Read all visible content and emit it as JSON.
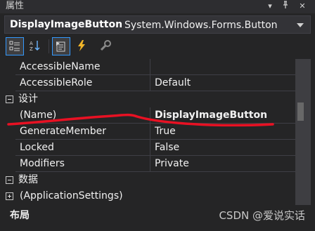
{
  "window": {
    "title": "属性",
    "pin_glyph": "▾",
    "autohide_glyph": "⊣",
    "close_glyph": "✕"
  },
  "object_selector": {
    "name": "DisplayImageButton",
    "type": "System.Windows.Forms.Button"
  },
  "toolbar": {
    "buttons": [
      {
        "icon": "categorized-icon",
        "active": true
      },
      {
        "icon": "alphabetical-icon",
        "active": false
      },
      {
        "icon": "properties-icon",
        "active": true
      },
      {
        "icon": "events-lightning-icon",
        "active": false
      },
      {
        "icon": "property-pages-wrench-icon",
        "active": false
      }
    ]
  },
  "grid": {
    "rows_top": [
      {
        "name": "AccessibleName",
        "value": ""
      },
      {
        "name": "AccessibleRole",
        "value": "Default"
      }
    ],
    "category_design": "设计",
    "rows_design": [
      {
        "name": "(Name)",
        "value": "DisplayImageButton"
      },
      {
        "name": "GenerateMember",
        "value": "True"
      },
      {
        "name": "Locked",
        "value": "False"
      },
      {
        "name": "Modifiers",
        "value": "Private"
      }
    ],
    "category_data": "数据",
    "sub_category": "(ApplicationSettings)"
  },
  "description": {
    "title": "布局"
  },
  "watermark": "CSDN @爱说实话",
  "colors": {
    "background": "#252526",
    "border": "#3f3f46",
    "highlight_red": "#e81123",
    "selection_blue": "#3399ff"
  }
}
